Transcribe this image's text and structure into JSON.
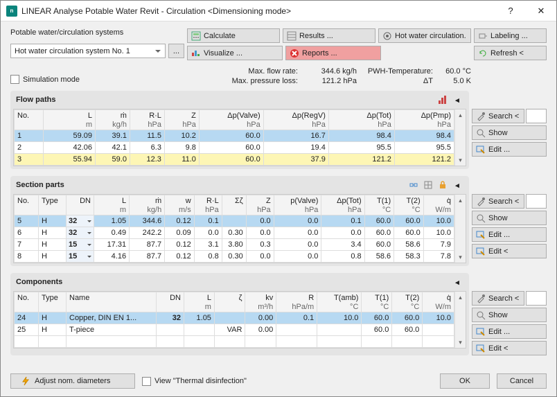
{
  "window": {
    "title": "LINEAR Analyse Potable Water Revit - Circulation <Dimensioning mode>"
  },
  "left": {
    "label": "Potable water/circulation systems",
    "combo": "Hot water circulation system No. 1",
    "sim": "Simulation mode"
  },
  "mid": {
    "b": {
      "calc": "Calculate",
      "results": "Results ...",
      "hot": "Hot water circulation.",
      "vis": "Visualize ...",
      "rep": "Reports ..."
    },
    "s": {
      "mfr": "Max. flow rate:",
      "mfrv": "344.6 kg/h",
      "pwh": "PWH-Temperature:",
      "pwhv": "60.0 °C",
      "mpl": "Max. pressure loss:",
      "mplv": "121.2 hPa",
      "dt": "ΔT",
      "dtv": "5.0 K"
    }
  },
  "right": {
    "label": "Labeling ...",
    "refresh": "Refresh <"
  },
  "side": {
    "search": "Search <",
    "show": "Show",
    "edit": "Edit ...",
    "editg": "Edit <"
  },
  "flow": {
    "title": "Flow paths",
    "h1": [
      "No.",
      "L",
      "ṁ",
      "R·L",
      "Z",
      "Δp(Valve)",
      "Δp(RegV)",
      "Δp(Tot)",
      "Δp(Pmp)"
    ],
    "h2": [
      "",
      "m",
      "kg/h",
      "hPa",
      "hPa",
      "hPa",
      "hPa",
      "hPa",
      "hPa"
    ],
    "rows": [
      [
        "1",
        "59.09",
        "39.1",
        "11.5",
        "10.2",
        "60.0",
        "16.7",
        "98.4",
        "98.4"
      ],
      [
        "2",
        "42.06",
        "42.1",
        "6.3",
        "9.8",
        "60.0",
        "19.4",
        "95.5",
        "95.5"
      ],
      [
        "3",
        "55.94",
        "59.0",
        "12.3",
        "11.0",
        "60.0",
        "37.9",
        "121.2",
        "121.2"
      ]
    ]
  },
  "sect": {
    "title": "Section parts",
    "h1": [
      "No.",
      "Type",
      "DN",
      "L",
      "ṁ",
      "w",
      "R·L",
      "Σζ",
      "Z",
      "p(Valve)",
      "Δp(Tot)",
      "T(1)",
      "T(2)",
      "q̇"
    ],
    "h2": [
      "",
      "",
      "",
      "m",
      "kg/h",
      "m/s",
      "hPa",
      "",
      "hPa",
      "hPa",
      "hPa",
      "°C",
      "°C",
      "W/m"
    ],
    "rows": [
      [
        "5",
        "H",
        "32",
        "1.05",
        "344.6",
        "0.12",
        "0.1",
        "",
        "0.0",
        "0.0",
        "0.1",
        "60.0",
        "60.0",
        "10.0"
      ],
      [
        "6",
        "H",
        "32",
        "0.49",
        "242.2",
        "0.09",
        "0.0",
        "0.30",
        "0.0",
        "0.0",
        "0.0",
        "60.0",
        "60.0",
        "10.0"
      ],
      [
        "7",
        "H",
        "15",
        "17.31",
        "87.7",
        "0.12",
        "3.1",
        "3.80",
        "0.3",
        "0.0",
        "3.4",
        "60.0",
        "58.6",
        "7.9"
      ],
      [
        "8",
        "H",
        "15",
        "4.16",
        "87.7",
        "0.12",
        "0.8",
        "0.30",
        "0.0",
        "0.0",
        "0.8",
        "58.6",
        "58.3",
        "7.8"
      ]
    ]
  },
  "comp": {
    "title": "Components",
    "h1": [
      "No.",
      "Type",
      "Name",
      "DN",
      "L",
      "ζ",
      "kv",
      "R",
      "T(amb)",
      "T(1)",
      "T(2)",
      "q̇"
    ],
    "h2": [
      "",
      "",
      "",
      "",
      "m",
      "",
      "m³/h",
      "hPa/m",
      "°C",
      "°C",
      "°C",
      "W/m"
    ],
    "rows": [
      [
        "24",
        "H",
        "Copper, DIN EN 1...",
        "32",
        "1.05",
        "",
        "0.00",
        "0.1",
        "10.0",
        "60.0",
        "60.0",
        "10.0"
      ],
      [
        "25",
        "H",
        "T-piece",
        "",
        "",
        "VAR",
        "0.00",
        "",
        "",
        "60.0",
        "60.0",
        ""
      ]
    ]
  },
  "foot": {
    "adj": "Adjust nom. diameters",
    "view": "View \"Thermal disinfection\"",
    "ok": "OK",
    "cancel": "Cancel"
  }
}
